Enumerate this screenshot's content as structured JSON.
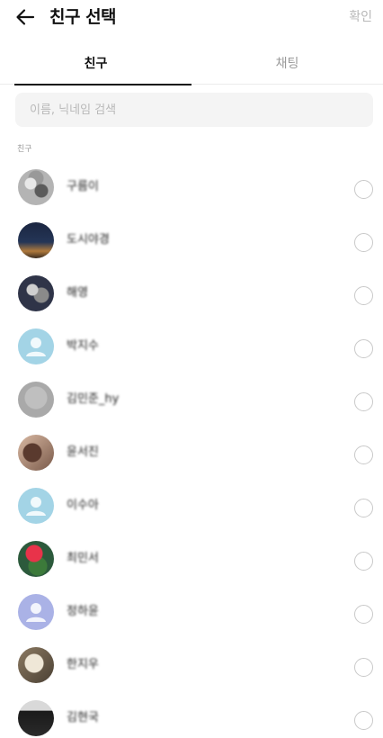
{
  "header": {
    "title": "친구 선택",
    "confirm_label": "확인"
  },
  "tabs": [
    {
      "label": "친구",
      "active": true
    },
    {
      "label": "채팅",
      "active": false
    }
  ],
  "search": {
    "placeholder": "이름, 닉네임 검색",
    "value": ""
  },
  "section_label": "친구",
  "friends": [
    {
      "name": "구름이",
      "avatar": "photo"
    },
    {
      "name": "도시야경",
      "avatar": "photo"
    },
    {
      "name": "해영",
      "avatar": "photo"
    },
    {
      "name": "박지수",
      "avatar": "default-blue"
    },
    {
      "name": "김민준_hy",
      "avatar": "photo"
    },
    {
      "name": "윤서진",
      "avatar": "photo"
    },
    {
      "name": "이수아",
      "avatar": "default-blue"
    },
    {
      "name": "최민서",
      "avatar": "photo"
    },
    {
      "name": "정하윤",
      "avatar": "default-purple"
    },
    {
      "name": "한지우",
      "avatar": "photo"
    },
    {
      "name": "김현국",
      "avatar": "photo"
    }
  ],
  "icons": {
    "back": "arrow-left-icon",
    "default_avatar": "person-icon",
    "select": "radio-circle-icon"
  },
  "colors": {
    "default_avatar_blue": "#a3d4e6",
    "default_avatar_purple": "#aab2e6",
    "tab_indicator": "#111111",
    "confirm_disabled": "#b8b8b8"
  }
}
